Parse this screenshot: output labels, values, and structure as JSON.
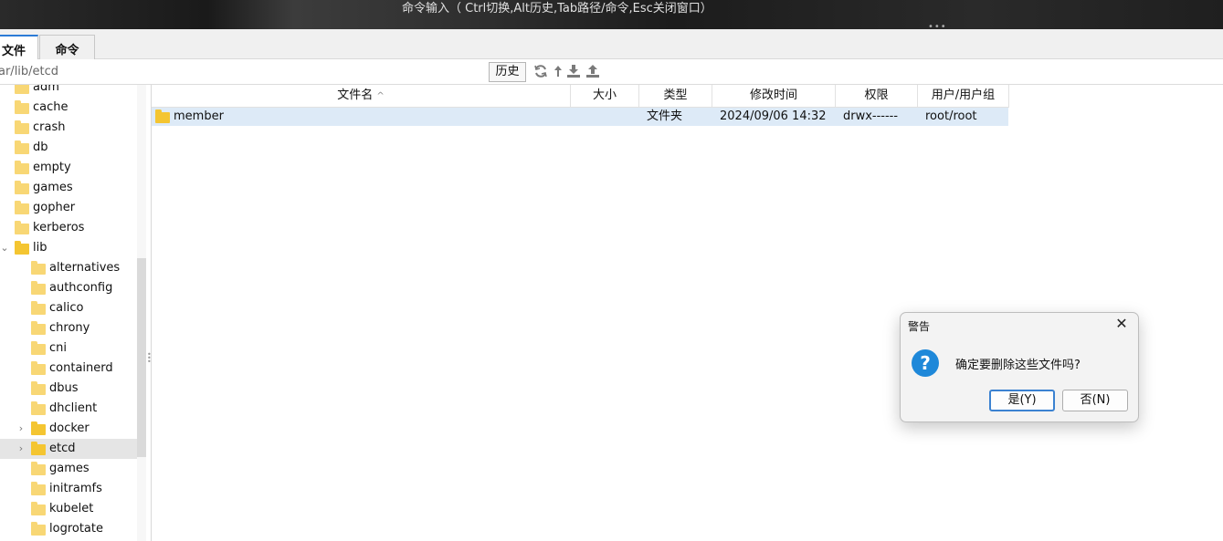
{
  "topbar": {
    "hint": "命令输入（ Ctrl切换,Alt历史,Tab路径/命令,Esc关闭窗口）",
    "dots": "•••"
  },
  "tabs": [
    {
      "label": "文件"
    },
    {
      "label": "命令"
    }
  ],
  "pathbar": {
    "path": "ar/lib/etcd",
    "history_label": "历史"
  },
  "toolbar_icons": [
    "refresh-icon",
    "up-arrow-icon",
    "download-icon",
    "upload-icon"
  ],
  "tree": {
    "items": [
      {
        "label": "adm"
      },
      {
        "label": "cache"
      },
      {
        "label": "crash"
      },
      {
        "label": "db"
      },
      {
        "label": "empty"
      },
      {
        "label": "games"
      },
      {
        "label": "gopher"
      },
      {
        "label": "kerberos"
      },
      {
        "label": "lib"
      },
      {
        "label": "alternatives"
      },
      {
        "label": "authconfig"
      },
      {
        "label": "calico"
      },
      {
        "label": "chrony"
      },
      {
        "label": "cni"
      },
      {
        "label": "containerd"
      },
      {
        "label": "dbus"
      },
      {
        "label": "dhclient"
      },
      {
        "label": "docker"
      },
      {
        "label": "etcd"
      },
      {
        "label": "games"
      },
      {
        "label": "initramfs"
      },
      {
        "label": "kubelet"
      },
      {
        "label": "logrotate"
      }
    ]
  },
  "columns": {
    "name": "文件名",
    "name_sort": "^",
    "size": "大小",
    "type": "类型",
    "mtime": "修改时间",
    "perm": "权限",
    "owner": "用户/用户组"
  },
  "files": [
    {
      "name": "member",
      "size": "",
      "type": "文件夹",
      "mtime": "2024/09/06 14:32",
      "perm": "drwx------",
      "owner": "root/root"
    }
  ],
  "dialog": {
    "title": "警告",
    "message": "确定要删除这些文件吗?",
    "yes_label": "是(Y)",
    "no_label": "否(N)"
  }
}
